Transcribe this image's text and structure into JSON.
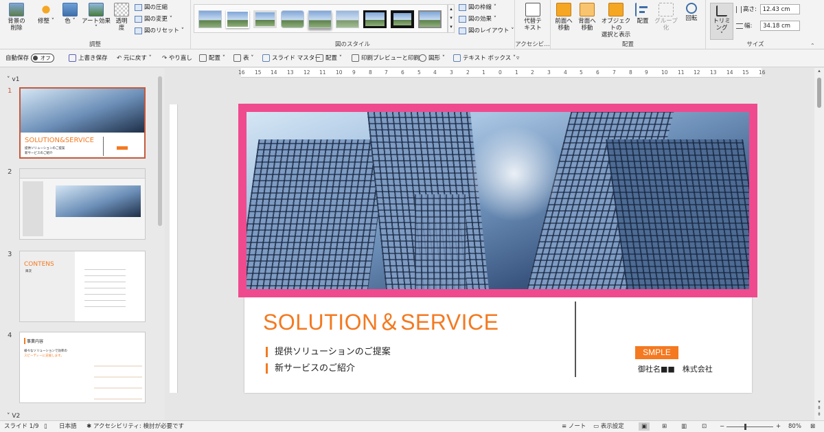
{
  "ribbon": {
    "adjust": {
      "label": "調整",
      "remove_bg": "背景の\n削除",
      "corrections": "修整",
      "color": "色",
      "artistic": "アート効果",
      "transparency": "透明\n度",
      "compress": "図の圧縮",
      "change": "図の変更",
      "reset": "図のリセット"
    },
    "styles": {
      "label": "図のスタイル",
      "border": "図の枠線",
      "effects": "図の効果",
      "layout": "図のレイアウト"
    },
    "accessibility": {
      "label": "アクセシビ…",
      "alt_text": "代替テ\nキスト"
    },
    "arrange": {
      "label": "配置",
      "bring_forward": "前面へ\n移動",
      "send_backward": "背面へ\n移動",
      "selection_pane": "オブジェクトの\n選択と表示",
      "align": "配置",
      "group": "グループ化",
      "rotate": "回転"
    },
    "size": {
      "label": "サイズ",
      "crop": "トリミング",
      "height_label": "高さ:",
      "height_value": "12.43 cm",
      "width_label": "幅:",
      "width_value": "34.18 cm"
    }
  },
  "qat": {
    "autosave": "自動保存",
    "toggle": "オフ",
    "save": "上書き保存",
    "undo": "元に戻す",
    "redo": "やり直し",
    "arrange": "配置",
    "table": "表",
    "slide_master": "スライド マスター",
    "arrange2": "配置",
    "print_preview": "印刷プレビューと印刷",
    "shapes": "図形",
    "textbox": "テキスト ボックス"
  },
  "ruler": {
    "ticks": [
      "16",
      "15",
      "14",
      "13",
      "12",
      "11",
      "10",
      "9",
      "8",
      "7",
      "6",
      "5",
      "4",
      "3",
      "2",
      "1",
      "0",
      "1",
      "2",
      "3",
      "4",
      "5",
      "6",
      "7",
      "8",
      "9",
      "10",
      "11",
      "12",
      "13",
      "14",
      "15",
      "16"
    ]
  },
  "slide_panel": {
    "section1": "v1",
    "section2": "V2",
    "slides": [
      {
        "num": "1",
        "title": "SOLUTION&SERVICE",
        "lines": [
          "提供ソリューションのご提案",
          "新サービスのご紹介"
        ]
      },
      {
        "num": "2"
      },
      {
        "num": "3",
        "title": "CONTENS",
        "sub": "目次"
      },
      {
        "num": "4",
        "title": "事業内容",
        "lines": [
          "様々なソリューションで効率の",
          "スピーディーに支援します。"
        ]
      }
    ]
  },
  "slide": {
    "title": "SOLUTION＆SERVICE",
    "bullets": [
      "提供ソリューションのご提案",
      "新サービスのご紹介"
    ],
    "badge": "SMPLE",
    "company": "御社名■■　株式会社"
  },
  "status": {
    "slide": "スライド 1/9",
    "language": "日本語",
    "accessibility": "アクセシビリティ: 検討が必要です",
    "notes": "ノート",
    "display": "表示設定",
    "zoom": "80%"
  },
  "colors": {
    "accent": "#f47920",
    "frame": "#f04a8e",
    "selected_thumb": "#c5593b"
  }
}
